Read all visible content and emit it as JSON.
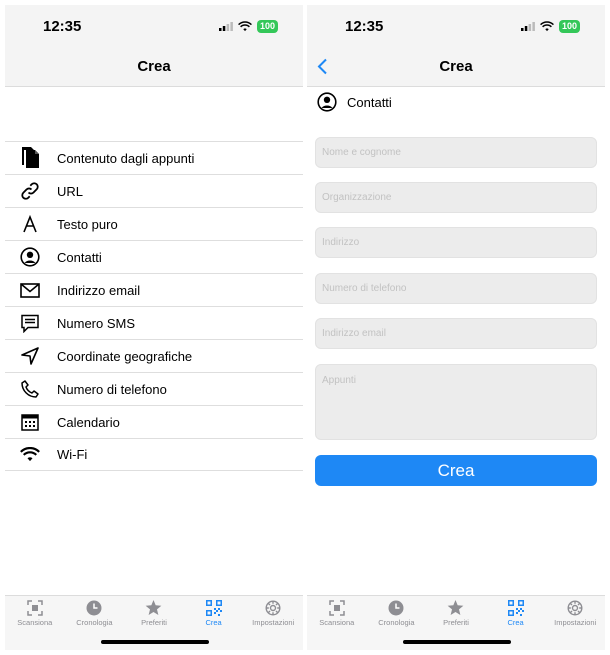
{
  "status": {
    "time": "12:35",
    "battery": "100"
  },
  "left": {
    "title": "Crea",
    "menu": [
      {
        "label": "Contenuto dagli appunti",
        "icon": "clipboard-icon"
      },
      {
        "label": "URL",
        "icon": "link-icon"
      },
      {
        "label": "Testo puro",
        "icon": "text-icon"
      },
      {
        "label": "Contatti",
        "icon": "person-circle-icon"
      },
      {
        "label": "Indirizzo email",
        "icon": "envelope-icon"
      },
      {
        "label": "Numero SMS",
        "icon": "message-icon"
      },
      {
        "label": "Coordinate geografiche",
        "icon": "location-arrow-icon"
      },
      {
        "label": "Numero di telefono",
        "icon": "phone-icon"
      },
      {
        "label": "Calendario",
        "icon": "calendar-icon"
      },
      {
        "label": "Wi-Fi",
        "icon": "wifi-icon"
      }
    ]
  },
  "right": {
    "title": "Crea",
    "section_title": "Contatti",
    "fields": {
      "name": "Nome e cognome",
      "organization": "Organizzazione",
      "address": "Indirizzo",
      "phone": "Numero di telefono",
      "email": "Indirizzo email",
      "notes": "Appunti"
    },
    "create_button": "Crea"
  },
  "tabs": [
    {
      "label": "Scansiona",
      "icon": "qr-scan-icon"
    },
    {
      "label": "Cronologia",
      "icon": "clock-icon"
    },
    {
      "label": "Preferiti",
      "icon": "star-icon"
    },
    {
      "label": "Crea",
      "icon": "qr-code-icon"
    },
    {
      "label": "Impostazioni",
      "icon": "gear-icon"
    }
  ],
  "colors": {
    "accent": "#1e88f5",
    "inactive": "#8e8e93",
    "battery": "#34c759"
  }
}
